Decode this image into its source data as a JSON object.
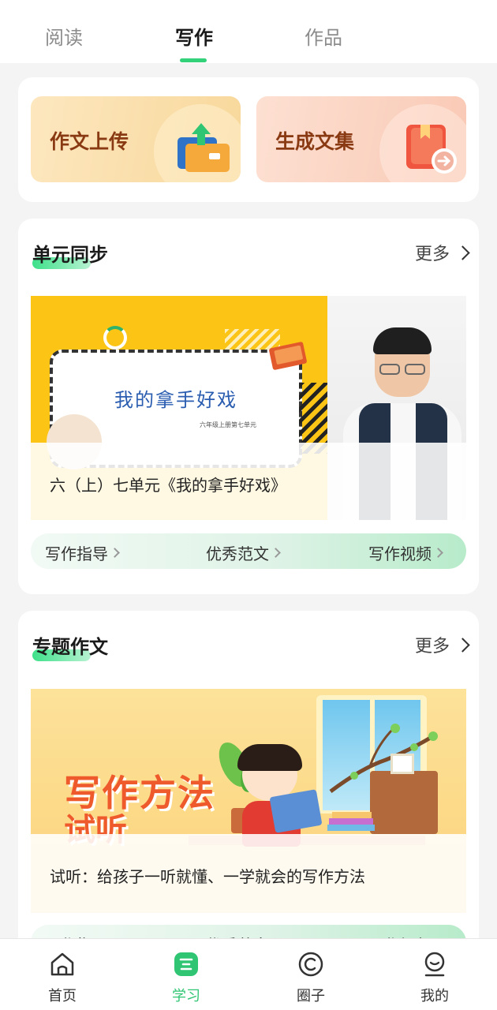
{
  "top_tabs": [
    {
      "label": "阅读",
      "active": false
    },
    {
      "label": "写作",
      "active": true
    },
    {
      "label": "作品",
      "active": false
    }
  ],
  "quick_actions": [
    {
      "label": "作文上传",
      "icon": "folder-upload-icon"
    },
    {
      "label": "生成文集",
      "icon": "book-collection-icon"
    }
  ],
  "unit_sync": {
    "title": "单元同步",
    "more": "更多",
    "banner": {
      "slide_title": "我的拿手好戏",
      "slide_subtitle": "六年级上册第七单元",
      "caption": "六（上）七单元《我的拿手好戏》"
    },
    "links": [
      "写作指导",
      "优秀范文",
      "写作视频"
    ]
  },
  "topic_essay": {
    "title": "专题作文",
    "more": "更多",
    "banner": {
      "headline": "写作方法",
      "subheadline": "试听",
      "caption": "试听：给孩子一听就懂、一学就会的写作方法"
    },
    "links": [
      "写作指导",
      "优秀范文",
      "写作视频"
    ]
  },
  "bottom_nav": [
    {
      "label": "首页",
      "icon": "home-icon",
      "active": false
    },
    {
      "label": "学习",
      "icon": "study-icon",
      "active": true
    },
    {
      "label": "圈子",
      "icon": "circle-icon",
      "active": false
    },
    {
      "label": "我的",
      "icon": "profile-icon",
      "active": false
    }
  ],
  "colors": {
    "accent": "#33d17a",
    "quick_upload_bg": "#fbe3b6",
    "quick_collection_bg": "#fcd9cb"
  }
}
